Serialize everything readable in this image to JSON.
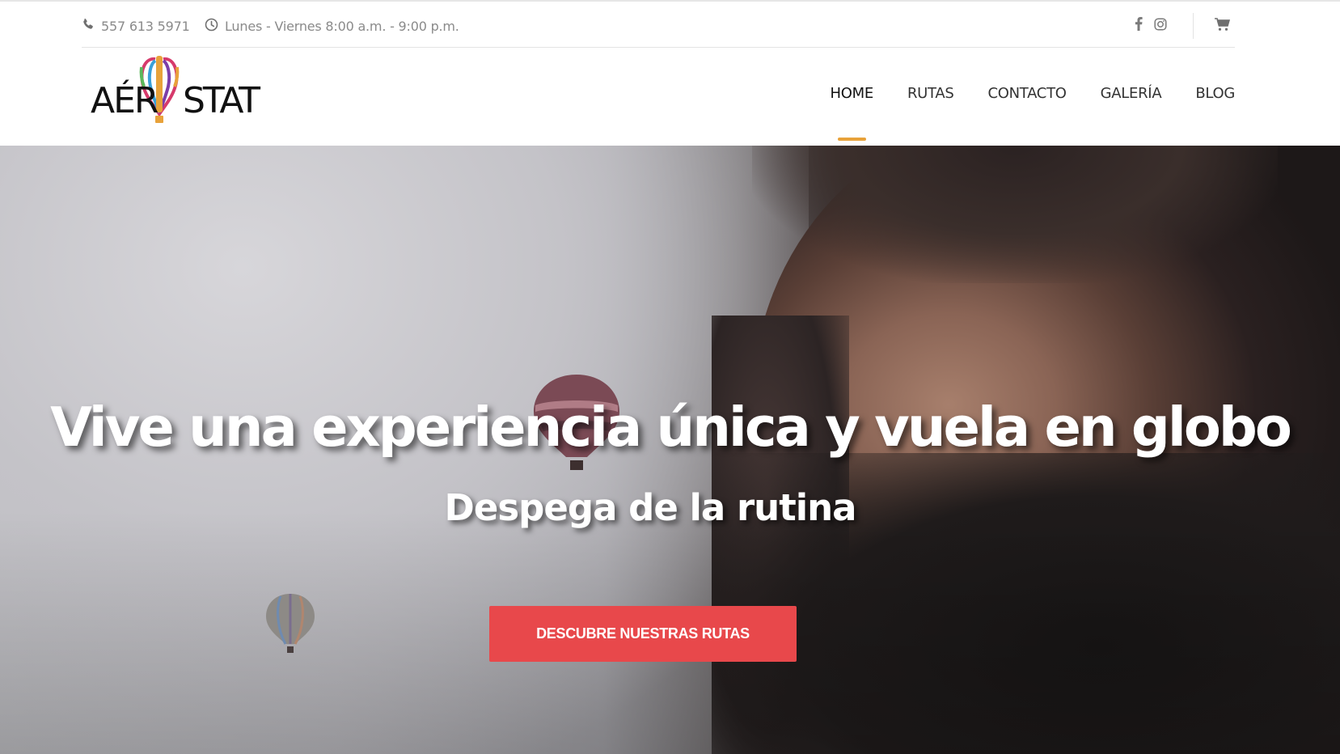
{
  "topbar": {
    "phone": "557 613 5971",
    "hours": "Lunes - Viernes 8:00 a.m. - 9:00 p.m.",
    "icons": [
      "phone-icon",
      "clock-icon",
      "facebook-icon",
      "instagram-icon",
      "cart-icon"
    ]
  },
  "header": {
    "logo_text": "AÉRSTAT",
    "nav": [
      {
        "label": "HOME",
        "active": true
      },
      {
        "label": "RUTAS",
        "active": false
      },
      {
        "label": "CONTACTO",
        "active": false
      },
      {
        "label": "GALERÍA",
        "active": false
      },
      {
        "label": "BLOG",
        "active": false
      }
    ],
    "accent_color": "#e8a23a"
  },
  "hero": {
    "title": "Vive una experiencia única y vuela en globo",
    "subtitle": "Despega de la rutina",
    "cta_label": "DESCUBRE NUESTRAS RUTAS",
    "cta_color": "#e8484b"
  }
}
